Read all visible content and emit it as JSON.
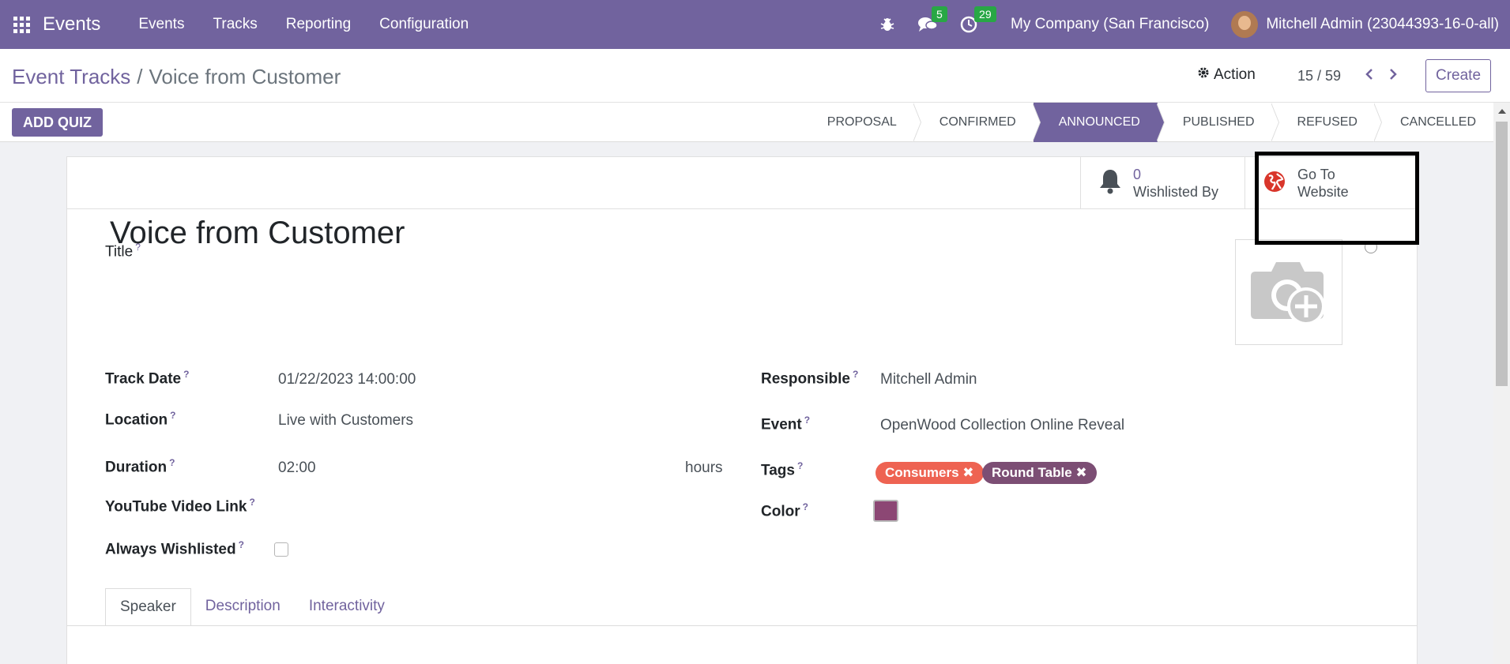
{
  "navbar": {
    "brand": "Events",
    "menu": [
      "Events",
      "Tracks",
      "Reporting",
      "Configuration"
    ],
    "messages_count": "5",
    "activities_count": "29",
    "company": "My Company (San Francisco)",
    "user": "Mitchell Admin (23044393-16-0-all)"
  },
  "control_panel": {
    "breadcrumb_parent": "Event Tracks",
    "breadcrumb_separator": "/",
    "breadcrumb_current": "Voice from Customer",
    "action_label": "Action",
    "pager": "15 / 59",
    "create_label": "Create"
  },
  "statusbar": {
    "quiz_button": "ADD QUIZ",
    "stages": [
      "PROPOSAL",
      "CONFIRMED",
      "ANNOUNCED",
      "PUBLISHED",
      "REFUSED",
      "CANCELLED"
    ],
    "active_stage": "ANNOUNCED"
  },
  "button_box": {
    "wishlist_value": "0",
    "wishlist_label": "Wishlisted By",
    "website_line1": "Go To",
    "website_line2": "Website"
  },
  "form": {
    "title_label": "Title",
    "title_value": "Voice from Customer",
    "track_date_label": "Track Date",
    "track_date_value": "01/22/2023 14:00:00",
    "location_label": "Location",
    "location_value": "Live with Customers",
    "duration_label": "Duration",
    "duration_value": "02:00",
    "duration_unit": "hours",
    "youtube_label": "YouTube Video Link",
    "always_wishlisted_label": "Always Wishlisted",
    "responsible_label": "Responsible",
    "responsible_value": "Mitchell Admin",
    "event_label": "Event",
    "event_value": "OpenWood Collection Online Reveal",
    "tags_label": "Tags",
    "tags": [
      "Consumers",
      "Round Table"
    ],
    "tag_remove_glyph": "✖",
    "color_label": "Color",
    "help_mark": "?"
  },
  "tabs": [
    "Speaker",
    "Description",
    "Interactivity"
  ],
  "colors": {
    "brand": "#71639e",
    "tag_consumers": "#ee6352",
    "tag_round_table": "#7c4e74",
    "color_field": "#8c4774",
    "badge": "#28a745"
  }
}
